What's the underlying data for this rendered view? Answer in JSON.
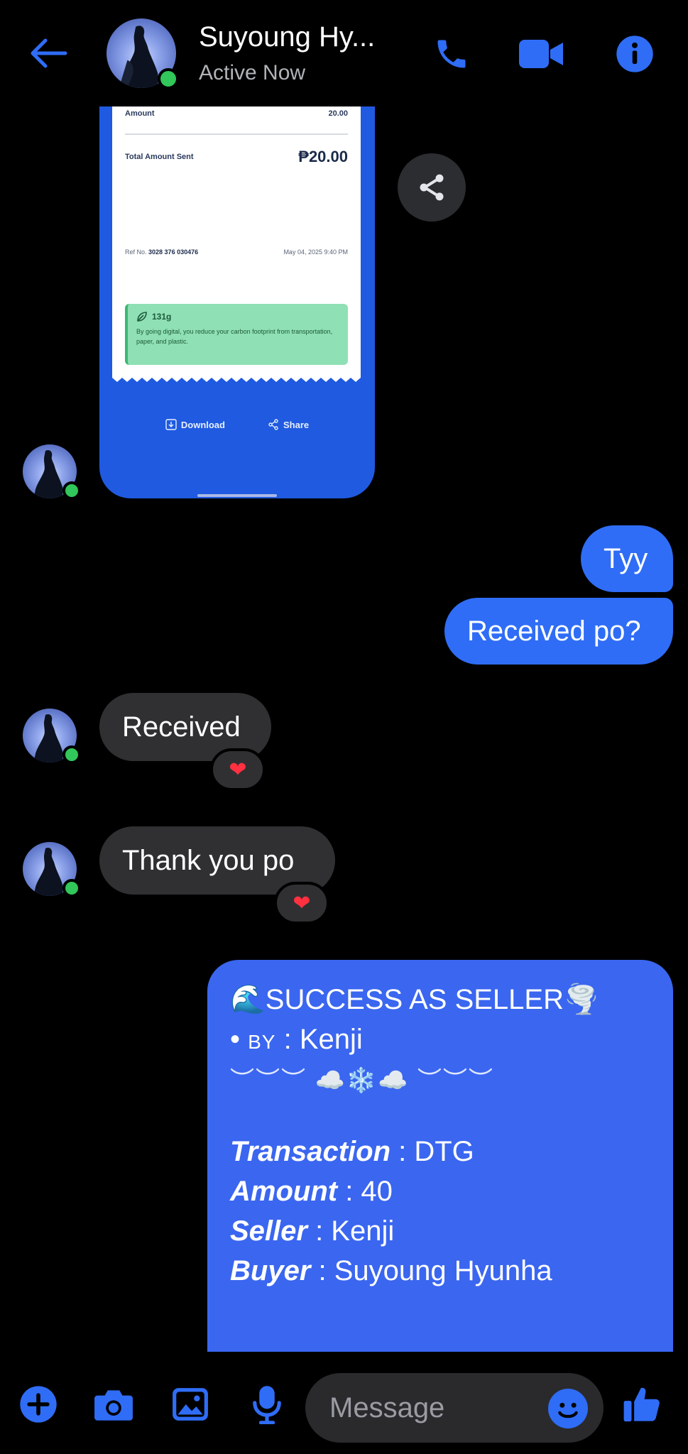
{
  "header": {
    "contact_name": "Suyoung Hy...",
    "status": "Active Now",
    "icons": [
      "back-arrow-icon",
      "phone-icon",
      "video-camera-icon",
      "info-icon"
    ],
    "accent_color": "#2f6df6"
  },
  "receipt": {
    "amount_label": "Amount",
    "amount_value": "20.00",
    "total_label": "Total Amount Sent",
    "total_value": "₱20.00",
    "ref_label": "Ref No.",
    "ref_value": "3028 376 030476",
    "date": "May 04, 2025 9:40 PM",
    "green_title": "131g",
    "green_sub": "By going digital, you reduce your carbon footprint from transportation, paper, and plastic.",
    "download_label": "Download",
    "share_label": "Share"
  },
  "messages": [
    {
      "from": "me",
      "text": "Tyy"
    },
    {
      "from": "me",
      "text": "Received po?"
    },
    {
      "from": "them",
      "text": "Received",
      "reaction": "❤"
    },
    {
      "from": "them",
      "text": "Thank you po",
      "reaction": "❤"
    }
  ],
  "long_message": {
    "title_line": "🌊SUCCESS AS SELLER🌪️",
    "by_prefix": "• ",
    "by_sc": "BY",
    "by_rest": " : Kenji",
    "deco_line": "︶︶︶ ☁️❄️☁️ ︶︶︶",
    "fields": [
      {
        "label": "Transaction",
        "value": " : DTG"
      },
      {
        "label": "Amount",
        "value": " : 40"
      },
      {
        "label": "Seller",
        "value": " : Kenji"
      },
      {
        "label": "Buyer",
        "value": " : Suyoung Hyunha"
      }
    ]
  },
  "composer": {
    "placeholder": "Message",
    "icons": [
      "plus-icon",
      "camera-icon",
      "gallery-icon",
      "microphone-icon",
      "emoji-icon",
      "thumbs-up-icon"
    ]
  }
}
